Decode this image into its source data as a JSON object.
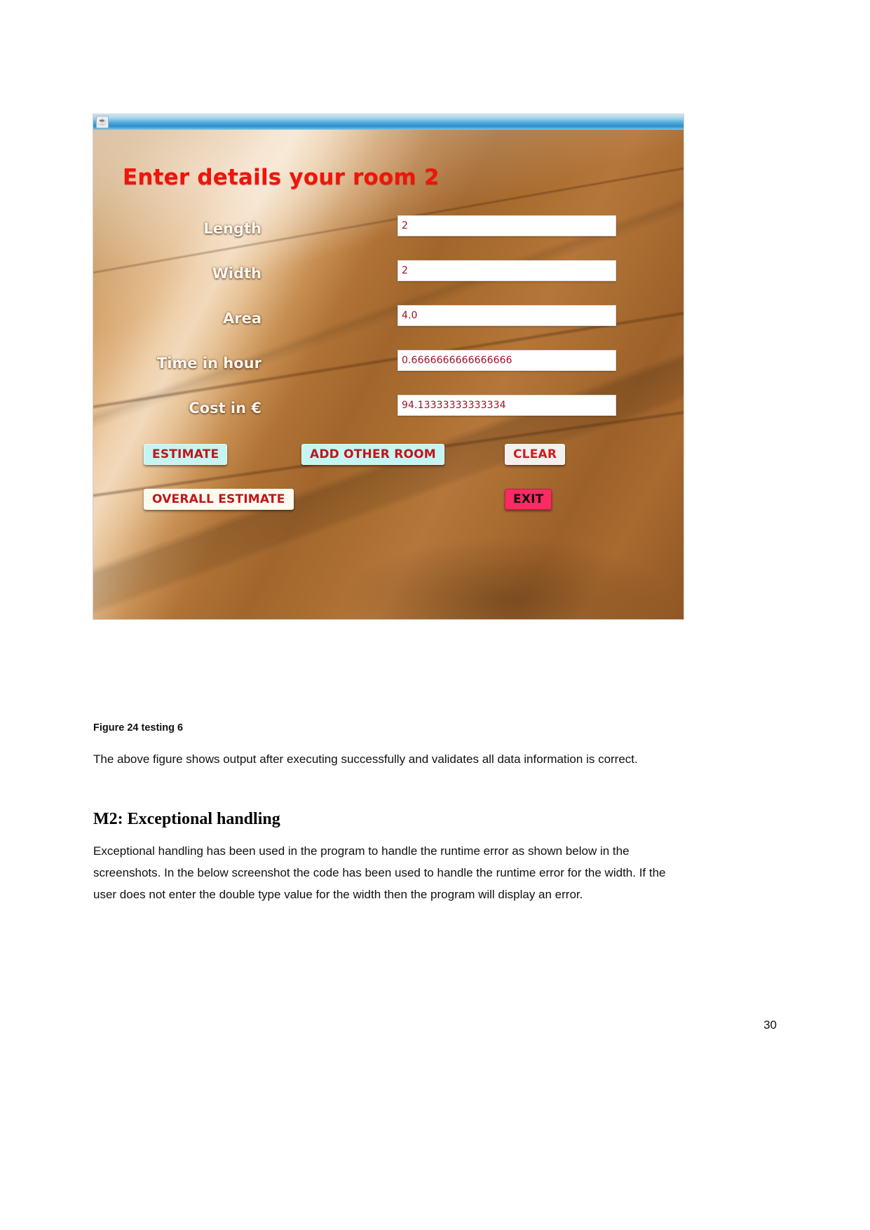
{
  "document": {
    "caption": "Figure 24 testing 6",
    "paragraph_1": "The above figure shows output after executing successfully and validates all data information is correct.",
    "section_heading": "M2: Exceptional handling",
    "paragraph_2": "Exceptional handling has been used in the program to handle the runtime error as shown below in the screenshots. In the below screenshot the code has been used to handle the runtime error for the width. If the user does not enter the double type value for the width then the program will display an error.",
    "page_number": "30"
  },
  "app_window": {
    "titlebar": {
      "icon": "java-coffee-cup-icon",
      "title": ""
    },
    "heading": "Enter details your room 2",
    "fields": [
      {
        "label": "Length",
        "value": "2"
      },
      {
        "label": "Width",
        "value": "2"
      },
      {
        "label": "Area",
        "value": "4.0"
      },
      {
        "label": "Time in hour",
        "value": "0.6666666666666666"
      },
      {
        "label": "Cost in €",
        "value": "94.13333333333334"
      }
    ],
    "buttons": [
      {
        "label": "ESTIMATE",
        "style": "cyan"
      },
      {
        "label": "ADD OTHER ROOM",
        "style": "cyan"
      },
      {
        "label": "CLEAR",
        "style": "white"
      },
      {
        "label": "OVERALL ESTIMATE",
        "style": "cream"
      },
      {
        "label": "EXIT",
        "style": "pink"
      }
    ],
    "colors": {
      "heading_red": "#f01409",
      "label_white": "#fdf6ec",
      "value_red": "#9e1127",
      "button_cyan": "#c4f5f2",
      "button_pink": "#fc2a63",
      "titlebar_blue": "#2b8fcc"
    }
  }
}
